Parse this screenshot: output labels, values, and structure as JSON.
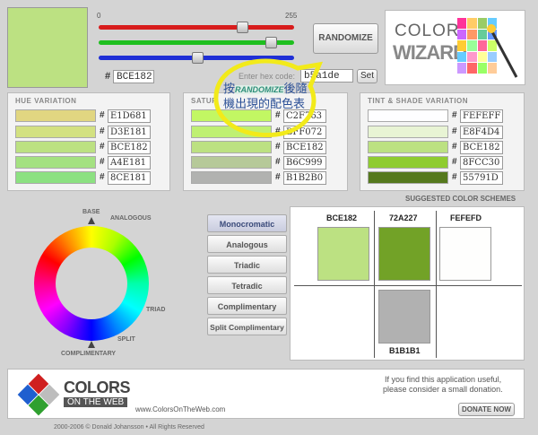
{
  "main_swatch": {
    "color": "#BCE182"
  },
  "sliders": {
    "min_label": "0",
    "max_label": "255",
    "red_value": 188,
    "green_value": 225,
    "blue_value": 130
  },
  "hex": {
    "hash": "#",
    "value": "BCE182"
  },
  "randomize": {
    "label": "RANDOMIZE"
  },
  "enter_hex": {
    "label": "Enter hex code:",
    "value": "b5a1de",
    "set_label": "Set"
  },
  "logo": {
    "color_text": "COLOR",
    "wizard_text": "WIZARD"
  },
  "annotation": {
    "line1_pre": "按",
    "line1_em": "RANDOMIZE",
    "line1_post": "後隨",
    "line2": "機出現的配色表"
  },
  "hue_variation": {
    "title": "HUE VARIATION",
    "rows": [
      {
        "hex": "E1D681",
        "color": "#E1D681"
      },
      {
        "hex": "D3E181",
        "color": "#D3E181"
      },
      {
        "hex": "BCE182",
        "color": "#BCE182"
      },
      {
        "hex": "A4E181",
        "color": "#A4E181"
      },
      {
        "hex": "8CE181",
        "color": "#8CE181"
      }
    ]
  },
  "saturation_variation": {
    "title": "SATUR",
    "rows": [
      {
        "hex": "C2F763",
        "color": "#C2F763"
      },
      {
        "hex": "BFF072",
        "color": "#BFF072"
      },
      {
        "hex": "BCE182",
        "color": "#BCE182"
      },
      {
        "hex": "B6C999",
        "color": "#B6C999"
      },
      {
        "hex": "B1B2B0",
        "color": "#B1B2B0"
      }
    ]
  },
  "tint_shade": {
    "title": "TINT & SHADE VARIATION",
    "rows": [
      {
        "hex": "FEFEFF",
        "color": "#FEFEFF"
      },
      {
        "hex": "E8F4D4",
        "color": "#E8F4D4"
      },
      {
        "hex": "BCE182",
        "color": "#BCE182"
      },
      {
        "hex": "8FCC30",
        "color": "#8FCC30"
      },
      {
        "hex": "55791D",
        "color": "#55791D"
      }
    ]
  },
  "wheel_labels": {
    "base": "BASE",
    "analogous": "ANALOGOUS",
    "triad": "TRIAD",
    "split": "SPLIT",
    "complimentary": "COMPLIMENTARY"
  },
  "scheme_buttons": [
    "Monocromatic",
    "Analogous",
    "Triadic",
    "Tetradic",
    "Complimentary",
    "Split Complimentary"
  ],
  "suggested": {
    "title": "SUGGESTED COLOR SCHEMES",
    "c1": {
      "label": "BCE182",
      "color": "#BCE182"
    },
    "c2": {
      "label": "72A227",
      "color": "#72A227"
    },
    "c3": {
      "label": "FEFEFD",
      "color": "#FEFEFD"
    },
    "c4": {
      "label": "B1B1B1",
      "color": "#B1B1B1"
    }
  },
  "footer": {
    "brand_colors": "COLORS",
    "brand_onweb": "ON THE WEB",
    "url": "www.ColorsOnTheWeb.com",
    "donate_text1": "If you find this application useful,",
    "donate_text2": "please consider a small donation.",
    "donate_btn": "DONATE NOW",
    "copyright": "2000-2006 © Donald Johansson • All Rights Reserved"
  }
}
